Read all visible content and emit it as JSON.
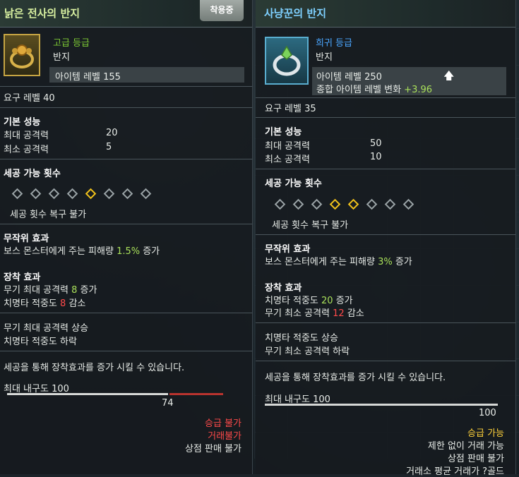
{
  "left": {
    "title": "낡은 전사의 반지",
    "badge": "착용중",
    "grade": "고급 등급",
    "type": "반지",
    "item_level": "아이템 레벨 155",
    "req_level": "요구 레벨 40",
    "base_title": "기본 성능",
    "stat1_label": "최대 공격력",
    "stat1_value": "20",
    "stat2_label": "최소 공격력",
    "stat2_value": "5",
    "craft_title": "세공 가능 횟수",
    "craft_note": "세공 횟수 복구 불가",
    "rand_title": "무작위 효과",
    "rand_pre": "보스 몬스터에게 주는 피해량 ",
    "rand_val": "1.5%",
    "rand_post": " 증가",
    "equip_title": "장착 효과",
    "eq1_pre": "무기 최대 공격력 ",
    "eq1_val": "8",
    "eq1_post": " 증가",
    "eq2_pre": "치명타 적중도 ",
    "eq2_val": "8",
    "eq2_post": " 감소",
    "sum1": "무기 최대 공격력 상승",
    "sum2": "치명타 적중도 하락",
    "craft_info": "세공을 통해 장착효과를 증가 시킬 수 있습니다.",
    "durability_label": "최대 내구도 100",
    "durability_value": "74",
    "f1": "승급 불가",
    "f2": "거래불가",
    "f3": "상점 판매 불가"
  },
  "right": {
    "title": "사냥꾼의 반지",
    "grade": "희귀 등급",
    "type": "반지",
    "item_level": "아이템 레벨 250",
    "total_change_label": "종합 아이템 레벨 변화 ",
    "total_change_value": "+3.96",
    "req_level": "요구 레벨 35",
    "base_title": "기본 성능",
    "stat1_label": "최대 공격력",
    "stat1_value": "50",
    "stat2_label": "최소 공격력",
    "stat2_value": "10",
    "craft_title": "세공 가능 횟수",
    "craft_note": "세공 횟수 복구 불가",
    "rand_title": "무작위 효과",
    "rand_pre": "보스 몬스터에게 주는 피해량 ",
    "rand_val": "3%",
    "rand_post": " 증가",
    "equip_title": "장착 효과",
    "eq1_pre": "치명타 적중도 ",
    "eq1_val": "20",
    "eq1_post": " 증가",
    "eq2_pre": "무기 최소 공격력 ",
    "eq2_val": "12",
    "eq2_post": " 감소",
    "sum1": "치명타 적중도 상승",
    "sum2": "무기 최소 공격력 하락",
    "craft_info": "세공을 통해 장착효과를 증가 시킬 수 있습니다.",
    "durability_label": "최대 내구도 100",
    "durability_value": "100",
    "f1": "승급 가능",
    "f2": "제한 없이 거래 가능",
    "f3": "상점 판매 불가",
    "f4": "거래소 평균 거래가 ?골드"
  },
  "colors": {
    "grade_uncommon": "#7cc834",
    "grade_rare": "#4aa6ff",
    "highlight": "#a9e05a",
    "negative": "#ff4a4a",
    "gem_active": "#f1c21b"
  },
  "icons": {
    "left_item": "gold-ring-icon",
    "right_item": "silver-ring-icon",
    "upgrade": "arrow-up-icon"
  }
}
